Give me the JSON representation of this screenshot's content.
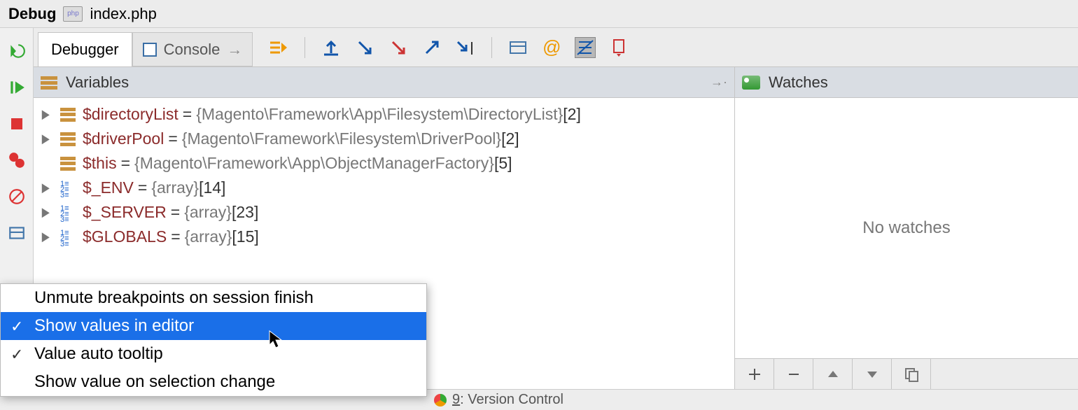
{
  "top": {
    "section": "Debug",
    "file": "index.php"
  },
  "tabs": {
    "debugger": "Debugger",
    "console": "Console"
  },
  "panes": {
    "variables_title": "Variables",
    "watches_title": "Watches",
    "no_watches": "No watches"
  },
  "variables": [
    {
      "name": "$directoryList",
      "value": "{Magento\\Framework\\App\\Filesystem\\DirectoryList}",
      "count": "[2]",
      "kind": "obj",
      "expandable": true
    },
    {
      "name": "$driverPool",
      "value": "{Magento\\Framework\\Filesystem\\DriverPool}",
      "count": "[2]",
      "kind": "obj",
      "expandable": true
    },
    {
      "name": "$this",
      "value": "{Magento\\Framework\\App\\ObjectManagerFactory}",
      "count": "[5]",
      "kind": "obj",
      "expandable": false
    },
    {
      "name": "$_ENV",
      "value": "{array}",
      "count": "[14]",
      "kind": "arr",
      "expandable": true
    },
    {
      "name": "$_SERVER",
      "value": "{array}",
      "count": "[23]",
      "kind": "arr",
      "expandable": true
    },
    {
      "name": "$GLOBALS",
      "value": "{array}",
      "count": "[15]",
      "kind": "arr",
      "expandable": true
    }
  ],
  "context_menu": [
    {
      "label": "Unmute breakpoints on session finish",
      "checked": false,
      "selected": false
    },
    {
      "label": "Show values in editor",
      "checked": true,
      "selected": true
    },
    {
      "label": "Value auto tooltip",
      "checked": true,
      "selected": false
    },
    {
      "label": "Show value on selection change",
      "checked": false,
      "selected": false
    }
  ],
  "bottom": {
    "vc_prefix": "9",
    "vc_label": ": Version Control"
  }
}
